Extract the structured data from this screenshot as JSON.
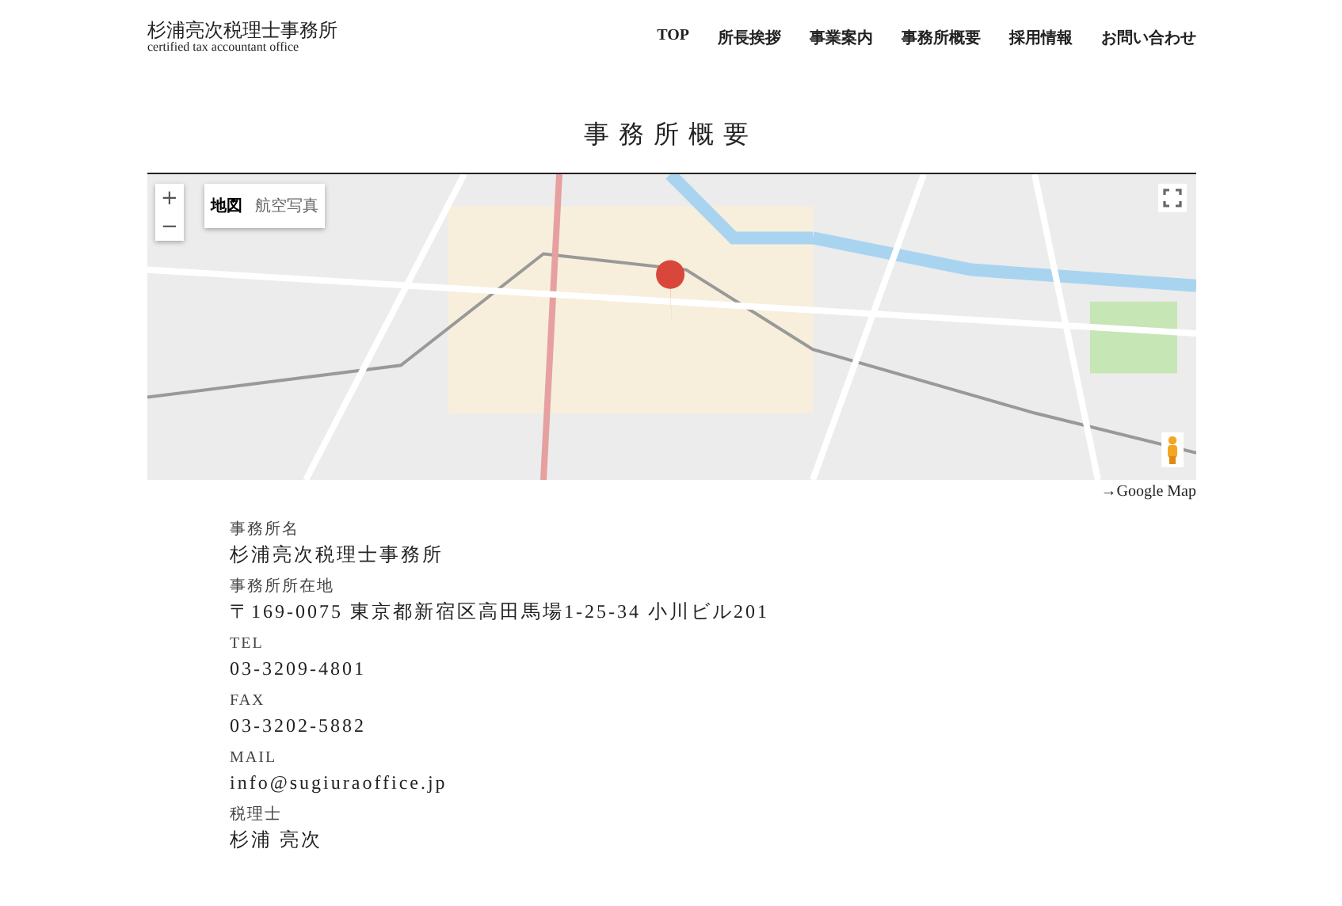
{
  "header": {
    "logo_title": "杉浦亮次税理士事務所",
    "logo_subtitle": "certified tax accountant office",
    "nav": [
      {
        "label": "TOP"
      },
      {
        "label": "所長挨拶"
      },
      {
        "label": "事業案内"
      },
      {
        "label": "事務所概要"
      },
      {
        "label": "採用情報"
      },
      {
        "label": "お問い合わせ"
      }
    ]
  },
  "page_title": "事務所概要",
  "map": {
    "zoom_in": "+",
    "zoom_out": "−",
    "map_types": [
      {
        "label": "地図",
        "selected": true
      },
      {
        "label": "航空写真",
        "selected": false
      }
    ]
  },
  "map_link": "→Google Map",
  "details": [
    {
      "label": "事務所名",
      "value": "杉浦亮次税理士事務所"
    },
    {
      "label": "事務所所在地",
      "value": "〒169-0075 東京都新宿区高田馬場1-25-34 小川ビル201"
    },
    {
      "label": "TEL",
      "value": "03-3209-4801"
    },
    {
      "label": "FAX",
      "value": "03-3202-5882"
    },
    {
      "label": "MAIL",
      "value": "info@sugiuraoffice.jp"
    },
    {
      "label": "税理士",
      "value": "杉浦 亮次"
    }
  ]
}
